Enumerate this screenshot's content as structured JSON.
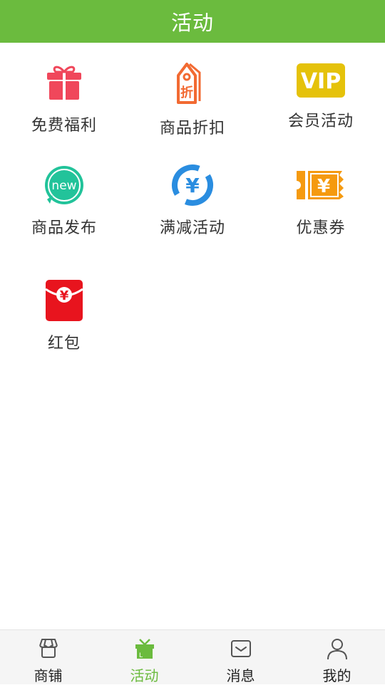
{
  "header": {
    "title": "活动"
  },
  "grid": {
    "items": [
      {
        "label": "免费福利",
        "icon": "gift-icon"
      },
      {
        "label": "商品折扣",
        "icon": "discount-tag-icon",
        "icon_text": "折"
      },
      {
        "label": "会员活动",
        "icon": "vip-badge-icon",
        "icon_text": "VIP"
      },
      {
        "label": "商品发布",
        "icon": "new-bubble-icon",
        "icon_text": "new"
      },
      {
        "label": "满减活动",
        "icon": "yuan-refresh-icon",
        "icon_text": "¥"
      },
      {
        "label": "优惠券",
        "icon": "coupon-icon",
        "icon_text": "¥"
      },
      {
        "label": "红包",
        "icon": "red-packet-icon",
        "icon_text": "¥"
      }
    ]
  },
  "tabbar": {
    "tabs": [
      {
        "label": "商铺",
        "icon": "shop-icon",
        "active": false
      },
      {
        "label": "活动",
        "icon": "activity-gift-icon",
        "active": true
      },
      {
        "label": "消息",
        "icon": "message-icon",
        "active": false
      },
      {
        "label": "我的",
        "icon": "profile-icon",
        "active": false
      }
    ]
  },
  "colors": {
    "brand_green": "#6bbb3e",
    "gift_red": "#f0475b",
    "tag_orange": "#f26a32",
    "vip_yellow": "#e5c20a",
    "new_teal": "#22c39a",
    "refresh_blue": "#2a8de0",
    "coupon_orange": "#f59a0f",
    "packet_red": "#e8141e"
  }
}
